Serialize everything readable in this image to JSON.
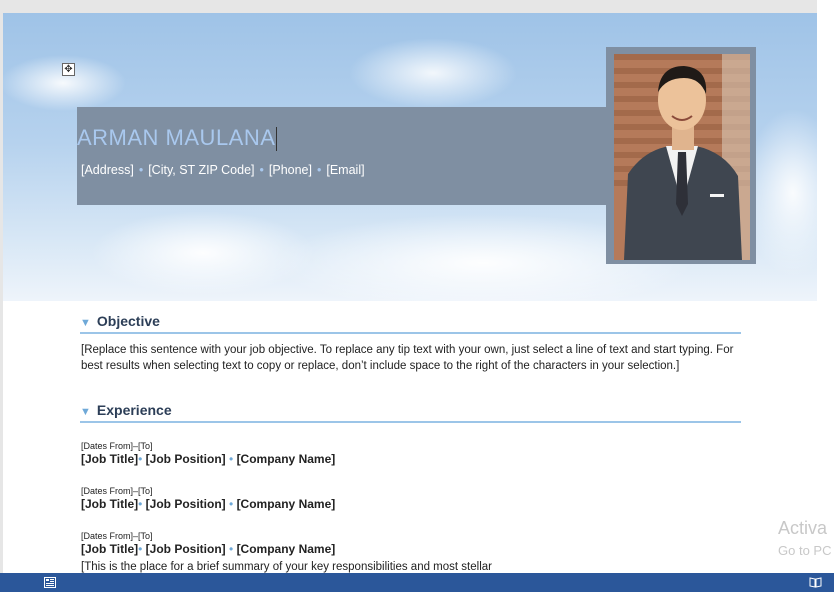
{
  "resume": {
    "name": "ARMAN MAULANA",
    "contact": {
      "address": "[Address]",
      "city": "[City, ST ZIP Code]",
      "phone": "[Phone]",
      "email": "[Email]",
      "separator": "•"
    }
  },
  "sections": {
    "objective": {
      "title": "Objective",
      "body": "[Replace this sentence with your job objective. To replace any tip text with your own, just select a line of text and start typing. For best results when selecting text to copy or replace, don’t include space to the right of the characters in your selection.]"
    },
    "experience": {
      "title": "Experience",
      "jobs": [
        {
          "dates": "[Dates From]–[To]",
          "title": "[Job Title]",
          "position": "[Job Position]",
          "company": "[Company Name]"
        },
        {
          "dates": "[Dates From]–[To]",
          "title": "[Job Title]",
          "position": "[Job Position]",
          "company": "[Company Name]"
        },
        {
          "dates": "[Dates From]–[To]",
          "title": "[Job Title]",
          "position": "[Job Position]",
          "company": "[Company Name]"
        }
      ],
      "summary": "[This is the place for a brief summary of your key responsibilities and most stellar"
    }
  },
  "watermark": {
    "line1": "Activa",
    "line2": "Go to PC"
  },
  "icons": {
    "move_handle": "move-icon",
    "status_left": "page-layout-icon",
    "status_right": "read-mode-icon"
  },
  "colors": {
    "header_band": "#7f8fa2",
    "name": "#a9c8ee",
    "accent": "#6fa9d8",
    "heading": "#2c3e57",
    "statusbar": "#2b579a"
  }
}
